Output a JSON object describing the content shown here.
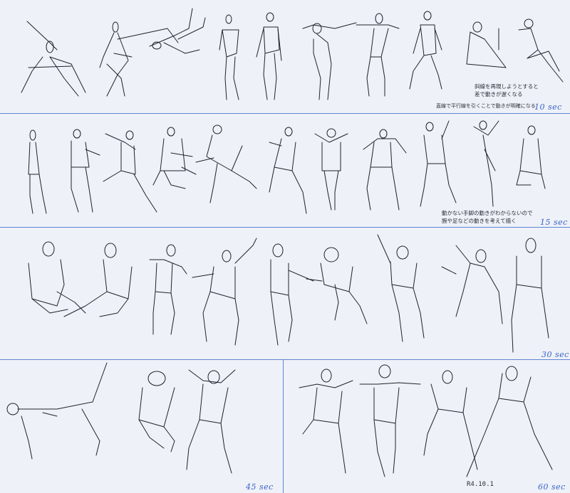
{
  "rows": [
    {
      "time_label": "10 sec",
      "notes": [
        "斜線を再現しようとすると",
        "差で動きが遅くなる",
        "直線で平行線を引くことで動きが明確になる"
      ]
    },
    {
      "time_label": "15 sec",
      "notes": [
        "動かない手脚の動きがわからないので",
        "腕や足などの動きを考えて描く"
      ]
    },
    {
      "time_label": "30 sec",
      "notes": []
    },
    {
      "time_label": "45 sec",
      "notes": []
    },
    {
      "time_label": "60 sec",
      "notes": []
    }
  ],
  "signature": "R4.10.1",
  "colors": {
    "background": "#eef1f7",
    "divider": "#5d86d6",
    "label": "#3a63c8",
    "ink": "#1e222b"
  }
}
